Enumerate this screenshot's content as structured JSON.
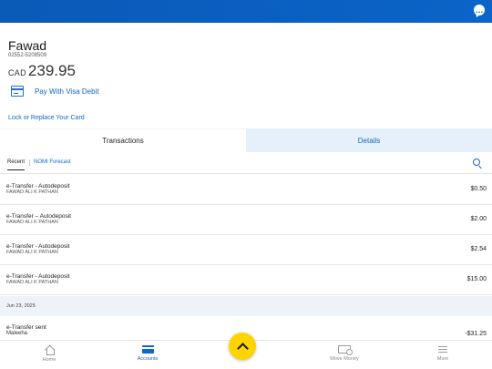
{
  "account": {
    "name": "Fawad",
    "number": "02552-5208509",
    "currency": "CAD",
    "balance": "239.95",
    "visa_debit_label": "Pay With Visa Debit",
    "lock_replace_link": "Lock or Replace Your Card"
  },
  "tabs": [
    {
      "label": "Transactions",
      "active": true
    },
    {
      "label": "Details",
      "active": false
    }
  ],
  "subtabs": {
    "recent": "Recent",
    "nomi": "NOMI Forecast"
  },
  "transactions": [
    {
      "title": "e-Transfer - Autodeposit",
      "subtitle": "FAWAD ALI K PATHAN",
      "amount": "$0.50"
    },
    {
      "title": "e-Transfer – Autodeposit",
      "subtitle": "FAWAD ALI K PATHAN",
      "amount": "$2.00"
    },
    {
      "title": "e-Transfer - Autodeposit",
      "subtitle": "FAWAD ALI K PATHAN",
      "amount": "$2.54"
    },
    {
      "title": "e-Transfer - Autodeposit",
      "subtitle": "FAWAD ALI K PATHAN",
      "amount": "$15.00"
    }
  ],
  "date_header": "Jun 23, 2025",
  "last_transaction": {
    "title": "e-Transfer sent",
    "subtitle": "Maleeha",
    "amount": "-$31.25"
  },
  "bottom_nav": {
    "home": "Home",
    "accounts": "Accounts",
    "move_money": "Move Money",
    "more": "More"
  },
  "colors": {
    "brand_blue": "#0b64c8",
    "link_blue": "#1366c6",
    "fab_yellow": "#ffd500",
    "tab_bg": "#e6f0fb"
  },
  "icons": [
    "chat-icon",
    "card-icon",
    "search-icon",
    "home-icon",
    "accounts-icon",
    "move-money-icon",
    "more-icon",
    "chevron-up-icon"
  ]
}
